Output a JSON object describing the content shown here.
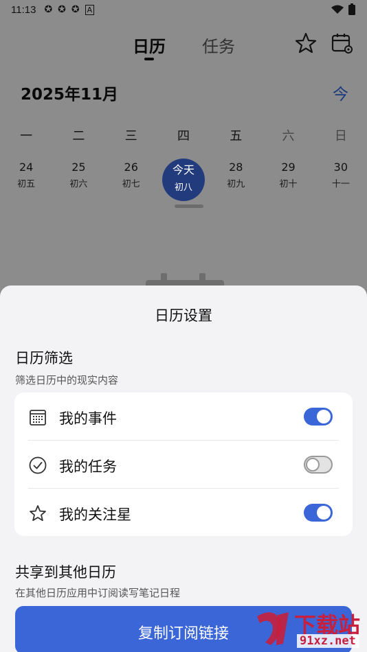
{
  "status_bar": {
    "time": "11:13",
    "left_icons": [
      "✪",
      "✪",
      "✪",
      "A"
    ]
  },
  "tabs": {
    "calendar": "日历",
    "tasks": "任务"
  },
  "header": {
    "month_title": "2025年11月",
    "today_button": "今"
  },
  "weekdays": [
    "一",
    "二",
    "三",
    "四",
    "五",
    "六",
    "日"
  ],
  "days": [
    {
      "num": "24",
      "lunar": "初五"
    },
    {
      "num": "25",
      "lunar": "初六"
    },
    {
      "num": "26",
      "lunar": "初七"
    },
    {
      "num": "今天",
      "lunar": "初八"
    },
    {
      "num": "28",
      "lunar": "初九"
    },
    {
      "num": "29",
      "lunar": "初十"
    },
    {
      "num": "30",
      "lunar": "十一"
    }
  ],
  "sheet": {
    "title": "日历设置",
    "filter_title": "日历筛选",
    "filter_sub": "筛选日历中的现实内容",
    "rows": [
      {
        "label": "我的事件",
        "on": true
      },
      {
        "label": "我的任务",
        "on": false
      },
      {
        "label": "我的关注星",
        "on": true
      }
    ],
    "share_title": "共享到其他日历",
    "share_sub": "在其他日历应用中订阅读写笔记日程",
    "copy_button": "复制订阅链接"
  },
  "watermark": {
    "main": "下载站",
    "sub": "91xz.net"
  },
  "colors": {
    "accent": "#3b66d8",
    "watermark": "#c81f3c"
  }
}
